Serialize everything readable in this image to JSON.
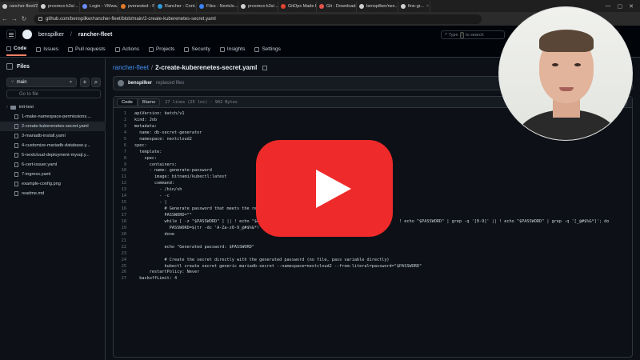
{
  "browser": {
    "tabs": [
      {
        "label": "rancher-fleet/2-c",
        "color": "#cfcfcf",
        "active": true
      },
      {
        "label": "proxmox-k3s/...",
        "color": "#cfcfcf"
      },
      {
        "label": "Login - VMwa...",
        "color": "#6b8cff"
      },
      {
        "label": "pvenested - P...",
        "color": "#e37b2a"
      },
      {
        "label": "Rancher - Cont...",
        "color": "#2d9ad8"
      },
      {
        "label": "Files - Nextclo...",
        "color": "#3b82f6"
      },
      {
        "label": "proxmox-k3s/...",
        "color": "#cfcfcf"
      },
      {
        "label": "GitOps Made E...",
        "color": "#e0432e"
      },
      {
        "label": "Git - Download...",
        "color": "#e5534b"
      },
      {
        "label": "benspilker/nex...",
        "color": "#cfcfcf"
      },
      {
        "label": "fine-gr...",
        "color": "#cfcfcf"
      }
    ],
    "url": "github.com/benspilker/rancher-fleet/blob/main/2-create-kuberenetes-secret.yaml"
  },
  "github": {
    "owner": "benspilker",
    "repo": "rancher-fleet",
    "search_placeholder": "Type",
    "search_key": "/",
    "search_suffix": "to search",
    "nav": [
      "Code",
      "Issues",
      "Pull requests",
      "Actions",
      "Projects",
      "Security",
      "Insights",
      "Settings"
    ]
  },
  "sidebar": {
    "title": "Files",
    "branch": "main",
    "goto_placeholder": "Go to file",
    "tree": [
      {
        "label": "init-test",
        "kind": "folder"
      },
      {
        "label": "1-make-namespace-permissions....",
        "kind": "file"
      },
      {
        "label": "2-create-kuberenetes-secret.yaml",
        "kind": "file",
        "selected": true
      },
      {
        "label": "3-mariadb-install.yaml",
        "kind": "file"
      },
      {
        "label": "4-customize-mariadb-database.y...",
        "kind": "file"
      },
      {
        "label": "5-nextcloud-deployment-mysql.y...",
        "kind": "file"
      },
      {
        "label": "6-cert-issuer.yaml",
        "kind": "file"
      },
      {
        "label": "7-ingress.yaml",
        "kind": "file"
      },
      {
        "label": "example-config.png",
        "kind": "file"
      },
      {
        "label": "readme.md",
        "kind": "file"
      }
    ]
  },
  "file": {
    "repo_link": "rancher-fleet",
    "sep": "/",
    "name": "2-create-kuberenetes-secret.yaml",
    "commit_author": "benspilker",
    "commit_message": "replaced files",
    "view_code": "Code",
    "view_blame": "Blame",
    "meta": "27 lines (25 loc) · 902 Bytes"
  },
  "code_lines": [
    {
      "n": "1",
      "t": "apiVersion: batch/v1"
    },
    {
      "n": "2",
      "t": "kind: Job"
    },
    {
      "n": "3",
      "t": "metadata:"
    },
    {
      "n": "4",
      "t": "  name: db-secret-generator"
    },
    {
      "n": "5",
      "t": "  namespace: nextcloud2"
    },
    {
      "n": "6",
      "t": "spec:"
    },
    {
      "n": "7",
      "t": "  template:"
    },
    {
      "n": "8",
      "t": "    spec:"
    },
    {
      "n": "9",
      "t": "      containers:"
    },
    {
      "n": "10",
      "t": "      - name: generate-password"
    },
    {
      "n": "11",
      "t": "        image: bitnami/kubectl:latest"
    },
    {
      "n": "12",
      "t": "        command:"
    },
    {
      "n": "13",
      "t": "          - /bin/sh"
    },
    {
      "n": "14",
      "t": "          - -c"
    },
    {
      "n": "15",
      "t": "          - |"
    },
    {
      "n": "16",
      "t": "            # Generate password that meets the requi"
    },
    {
      "n": "17",
      "t": "            PASSWORD=\"\""
    },
    {
      "n": "18",
      "t": "            while [ -z \"$PASSWORD\" ] || ! echo \"$PASSW                                                    ! echo \"$PASSWORD\" | grep -q '[0-9]' || ! echo \"$PASSWORD\" | grep -q '[_@#$%&*]'; do"
    },
    {
      "n": "19",
      "t": "              PASSWORD=$(tr -dc 'A-Za-z0-9_@#$%&*!'"
    },
    {
      "n": "20",
      "t": "            done"
    },
    {
      "n": "21",
      "t": ""
    },
    {
      "n": "22",
      "t": "            echo \"Generated password: $PASSWORD\""
    },
    {
      "n": "23",
      "t": ""
    },
    {
      "n": "24",
      "t": "            # Create the secret directly with the generated password (no file, pass variable directly)"
    },
    {
      "n": "25",
      "t": "            kubectl create secret generic mariadb-secret --namespace=nextcloud2 --from-literal=password=\"$PASSWORD\""
    },
    {
      "n": "26",
      "t": "      restartPolicy: Never"
    },
    {
      "n": "27",
      "t": "  backoffLimit: 4"
    }
  ]
}
